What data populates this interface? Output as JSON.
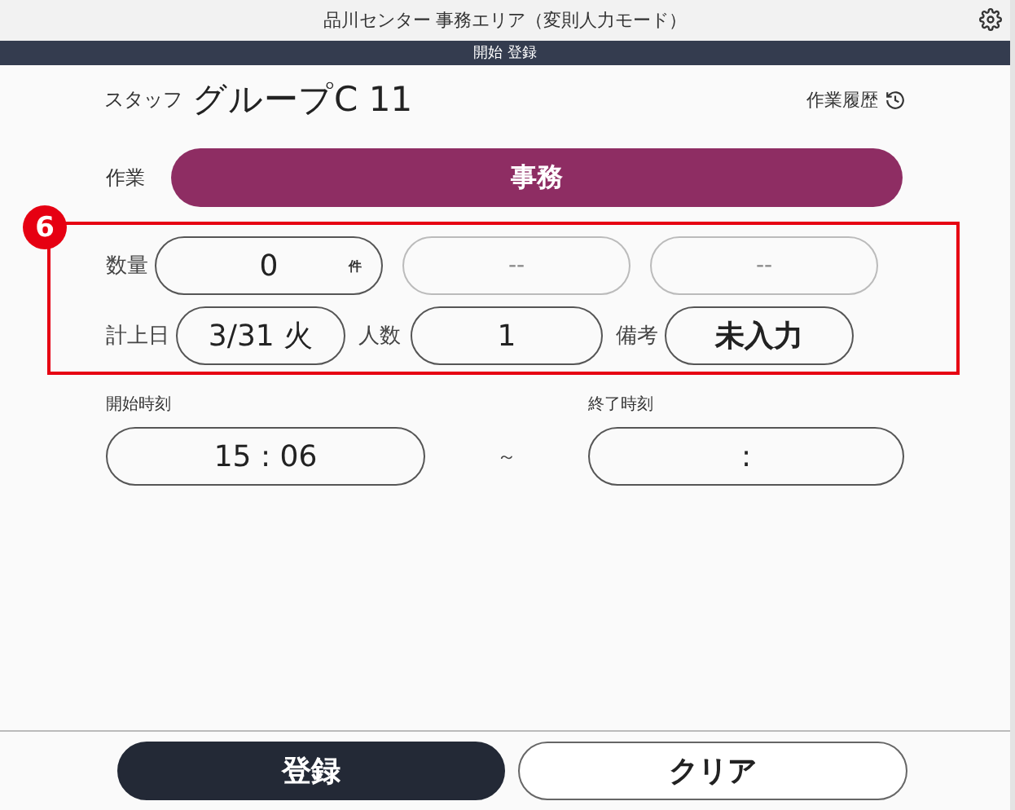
{
  "window": {
    "title": "品川センター 事務エリア（変則人力モード）"
  },
  "mode_bar": {
    "text": "開始 登録"
  },
  "staff": {
    "label": "スタッフ",
    "name": "グループC 11"
  },
  "history_link": {
    "label": "作業履歴"
  },
  "work": {
    "label": "作業",
    "value": "事務"
  },
  "annotation": {
    "number": "6"
  },
  "quantity": {
    "label": "数量",
    "fields": [
      {
        "value": "0",
        "unit": "件",
        "disabled": false
      },
      {
        "value": "--",
        "disabled": true
      },
      {
        "value": "--",
        "disabled": true
      }
    ]
  },
  "details": [
    {
      "label": "計上日",
      "value": "3/31 火"
    },
    {
      "label": "人数",
      "value": "1"
    },
    {
      "label": "備考",
      "value": "未入力"
    }
  ],
  "start_time": {
    "label": "開始時刻",
    "value": "15 : 06"
  },
  "separator": "～",
  "end_time": {
    "label": "終了時刻",
    "value": ":"
  },
  "buttons": [
    {
      "label": "登録",
      "kind": "primary"
    },
    {
      "label": "クリア",
      "kind": "secondary"
    }
  ]
}
